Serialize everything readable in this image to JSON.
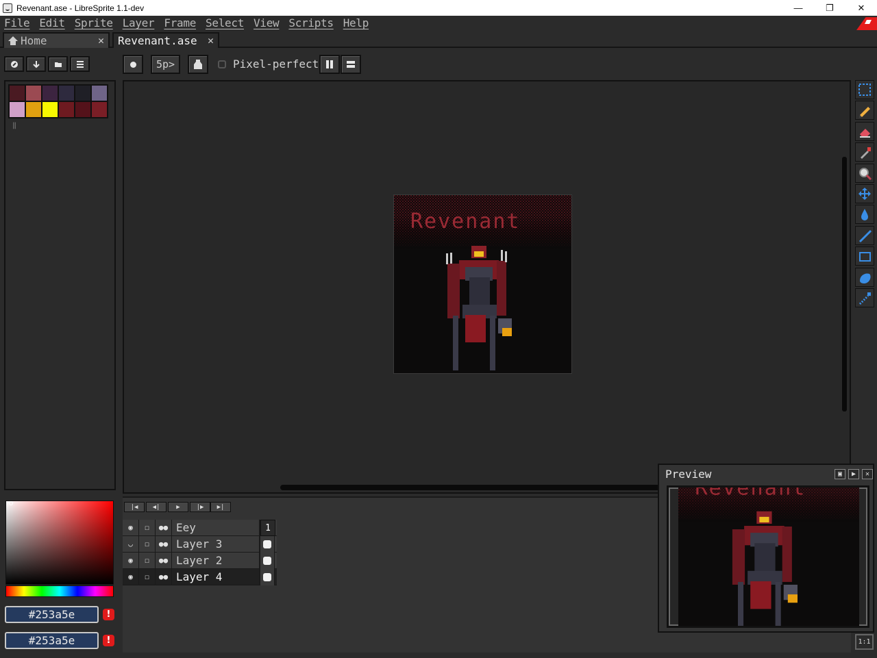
{
  "window": {
    "title": "Revenant.ase - LibreSprite 1.1-dev"
  },
  "menu": {
    "items": [
      "File",
      "Edit",
      "Sprite",
      "Layer",
      "Frame",
      "Select",
      "View",
      "Scripts",
      "Help"
    ]
  },
  "tabs": [
    {
      "label": "Home",
      "icon": "house-icon",
      "active": false
    },
    {
      "label": "Revenant.ase",
      "active": true
    }
  ],
  "toolbar": {
    "brush_size": "5p>",
    "pixel_perfect_label": "Pixel-perfect",
    "pixel_perfect_checked": false
  },
  "palette": {
    "colors": [
      "#4a1a22",
      "#9b4a52",
      "#3c2440",
      "#2e2a3e",
      "#1f1f26",
      "#6f6488",
      "#d0a0c8",
      "#e0a010",
      "#f8f800",
      "#6e1a20",
      "#54121a",
      "#7a1e26"
    ]
  },
  "colors": {
    "foreground_hex": "#253a5e",
    "background_hex": "#253a5e"
  },
  "layers": [
    {
      "name": "Eey",
      "visible": true,
      "locked": false
    },
    {
      "name": "Layer 3",
      "visible": false,
      "locked": false
    },
    {
      "name": "Layer 2",
      "visible": true,
      "locked": false
    },
    {
      "name": "Layer 4",
      "visible": true,
      "locked": false,
      "selected": true
    }
  ],
  "timeline": {
    "frame_number": "1"
  },
  "preview": {
    "title": "Preview"
  },
  "sprite": {
    "title_text": "Revenant"
  },
  "zoom_button": "1:1"
}
